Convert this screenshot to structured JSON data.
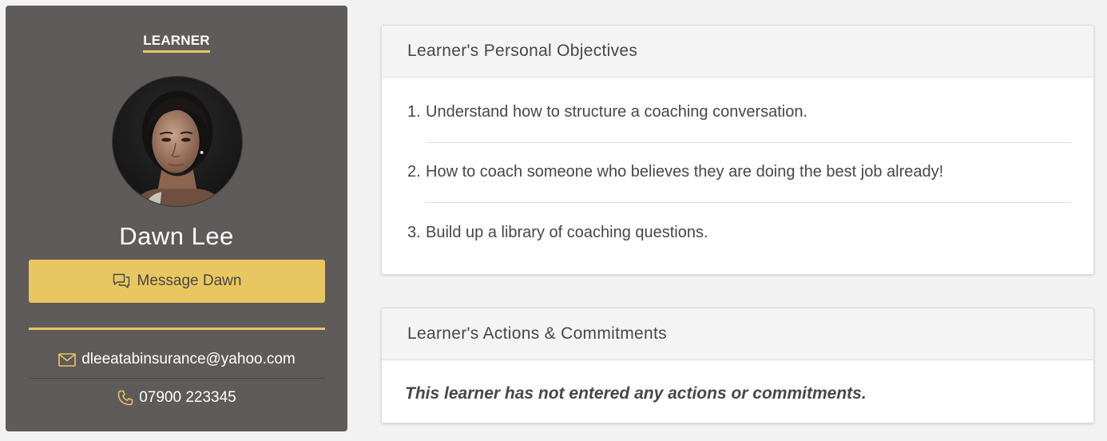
{
  "learner_card": {
    "label": "LEARNER",
    "name": "Dawn Lee",
    "message_button_label": "Message Dawn",
    "email": "dleeatabinsurance@yahoo.com",
    "phone": "07900 223345",
    "accent_color": "#e8c760",
    "background_color": "#5f5b5b",
    "icons": {
      "message": "chat-bubbles-icon",
      "email": "envelope-icon",
      "phone": "phone-icon"
    }
  },
  "objectives_panel": {
    "title": "Learner's Personal Objectives",
    "items": [
      {
        "number": "1.",
        "text": "Understand how to structure a coaching conversation."
      },
      {
        "number": "2.",
        "text": "How to coach someone who believes they are doing the best job already!"
      },
      {
        "number": "3.",
        "text": "Build up a library of coaching questions."
      }
    ]
  },
  "actions_panel": {
    "title": "Learner's Actions & Commitments",
    "empty_message": "This learner has not entered any actions or commitments."
  }
}
